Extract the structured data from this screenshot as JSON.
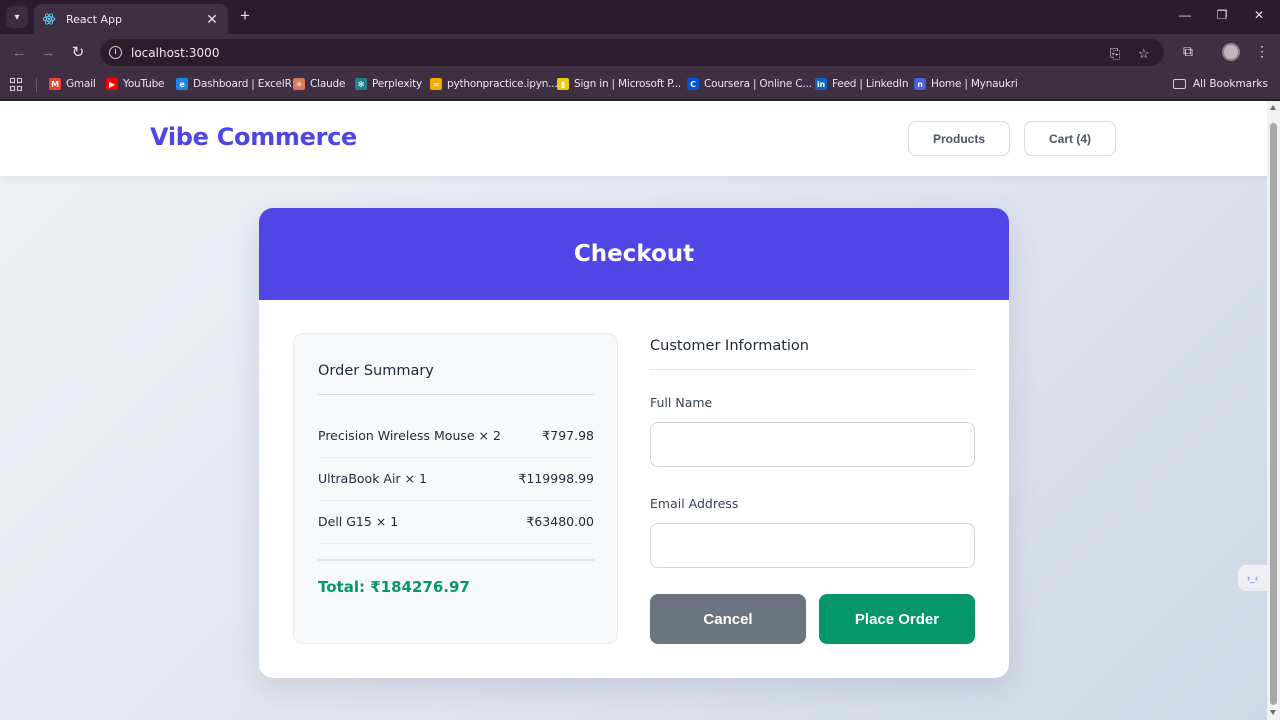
{
  "browser": {
    "tab_title": "React App",
    "url": "localhost:3000",
    "bookmarks": [
      {
        "label": "Gmail",
        "icon": "gmail-icon",
        "color": "#ea4335",
        "glyph": "M"
      },
      {
        "label": "YouTube",
        "icon": "youtube-icon",
        "color": "#ff0000",
        "glyph": "▶"
      },
      {
        "label": "Dashboard | ExcelR",
        "icon": "excelr-icon",
        "color": "#1e88e5",
        "glyph": "e"
      },
      {
        "label": "Claude",
        "icon": "claude-icon",
        "color": "#d97757",
        "glyph": "✳"
      },
      {
        "label": "Perplexity",
        "icon": "perplexity-icon",
        "color": "#20808d",
        "glyph": "✻"
      },
      {
        "label": "pythonpractice.ipyn...",
        "icon": "colab-icon",
        "color": "#f9ab00",
        "glyph": "∞"
      },
      {
        "label": "Sign in | Microsoft P...",
        "icon": "powerbi-icon",
        "color": "#f2c811",
        "glyph": "▮"
      },
      {
        "label": "Coursera | Online C...",
        "icon": "coursera-icon",
        "color": "#0056d2",
        "glyph": "C"
      },
      {
        "label": "Feed | LinkedIn",
        "icon": "linkedin-icon",
        "color": "#0a66c2",
        "glyph": "in"
      },
      {
        "label": "Home | Mynaukri",
        "icon": "naukri-icon",
        "color": "#4a60d8",
        "glyph": "n"
      }
    ],
    "all_bookmarks_label": "All Bookmarks"
  },
  "site": {
    "brand": "Vibe Commerce",
    "brand_color": "#4f46e5",
    "nav": {
      "products_label": "Products",
      "cart_label": "Cart (4)"
    }
  },
  "checkout": {
    "title": "Checkout",
    "header_color": "#5046e5",
    "summary": {
      "title": "Order Summary",
      "items": [
        {
          "name": "Precision Wireless Mouse × 2",
          "price": "₹797.98"
        },
        {
          "name": "UltraBook Air × 1",
          "price": "₹119998.99"
        },
        {
          "name": "Dell G15 × 1",
          "price": "₹63480.00"
        }
      ],
      "total": "Total: ₹184276.97",
      "total_color": "#059669"
    },
    "form": {
      "title": "Customer Information",
      "name_label": "Full Name",
      "name_value": "",
      "email_label": "Email Address",
      "email_value": "",
      "cancel_label": "Cancel",
      "place_order_label": "Place Order"
    }
  }
}
